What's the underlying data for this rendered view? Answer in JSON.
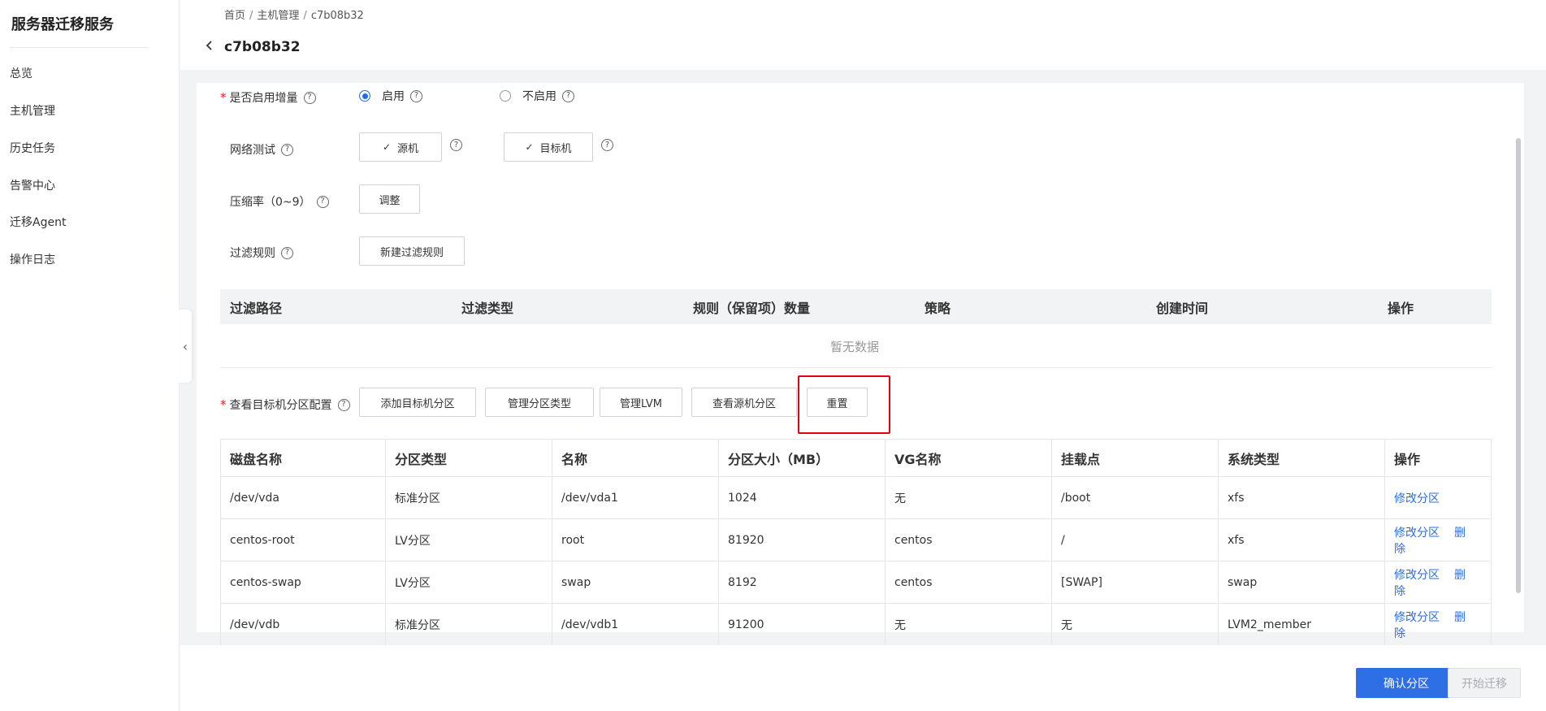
{
  "sidebar": {
    "title": "服务器迁移服务",
    "items": [
      {
        "label": "总览"
      },
      {
        "label": "主机管理"
      },
      {
        "label": "历史任务"
      },
      {
        "label": "告警中心"
      },
      {
        "label": "迁移Agent"
      },
      {
        "label": "操作日志"
      }
    ]
  },
  "header": {
    "breadcrumb": [
      "首页",
      "主机管理",
      "c7b08b32"
    ],
    "title": "c7b08b32"
  },
  "form": {
    "incremental": {
      "label": "是否启用增量",
      "options": [
        {
          "label": "启用"
        },
        {
          "label": "不启用"
        }
      ],
      "selected": "启用"
    },
    "network_test": {
      "label": "网络测试",
      "source_btn": "源机",
      "target_btn": "目标机"
    },
    "compression": {
      "label": "压缩率（0~9）",
      "button": "调整"
    },
    "filter": {
      "label": "过滤规则",
      "button": "新建过滤规则"
    },
    "filter_table": {
      "headers": [
        "过滤路径",
        "过滤类型",
        "规则（保留项）数量",
        "策略",
        "创建时间",
        "操作"
      ],
      "empty": "暂无数据"
    },
    "partition": {
      "label": "查看目标机分区配置",
      "buttons": [
        "添加目标机分区",
        "管理分区类型",
        "管理LVM",
        "查看源机分区",
        "重置"
      ]
    }
  },
  "partition_table": {
    "headers": [
      "磁盘名称",
      "分区类型",
      "名称",
      "分区大小（MB）",
      "VG名称",
      "挂载点",
      "系统类型",
      "操作"
    ],
    "rows": [
      [
        "/dev/vda",
        "标准分区",
        "/dev/vda1",
        "1024",
        "无",
        "/boot",
        "xfs"
      ],
      [
        "centos-root",
        "LV分区",
        "root",
        "81920",
        "centos",
        "/",
        "xfs"
      ],
      [
        "centos-swap",
        "LV分区",
        "swap",
        "8192",
        "centos",
        "[SWAP]",
        "swap"
      ],
      [
        "/dev/vdb",
        "标准分区",
        "/dev/vdb1",
        "91200",
        "无",
        "无",
        "LVM2_member"
      ]
    ],
    "actions": {
      "edit": "修改分区",
      "delete": "删除"
    }
  },
  "footer": {
    "confirm": "确认分区",
    "start": "开始迁移"
  },
  "colors": {
    "primary": "#2f6fe6",
    "link": "#2b6ee0",
    "highlight": "#e60012"
  }
}
